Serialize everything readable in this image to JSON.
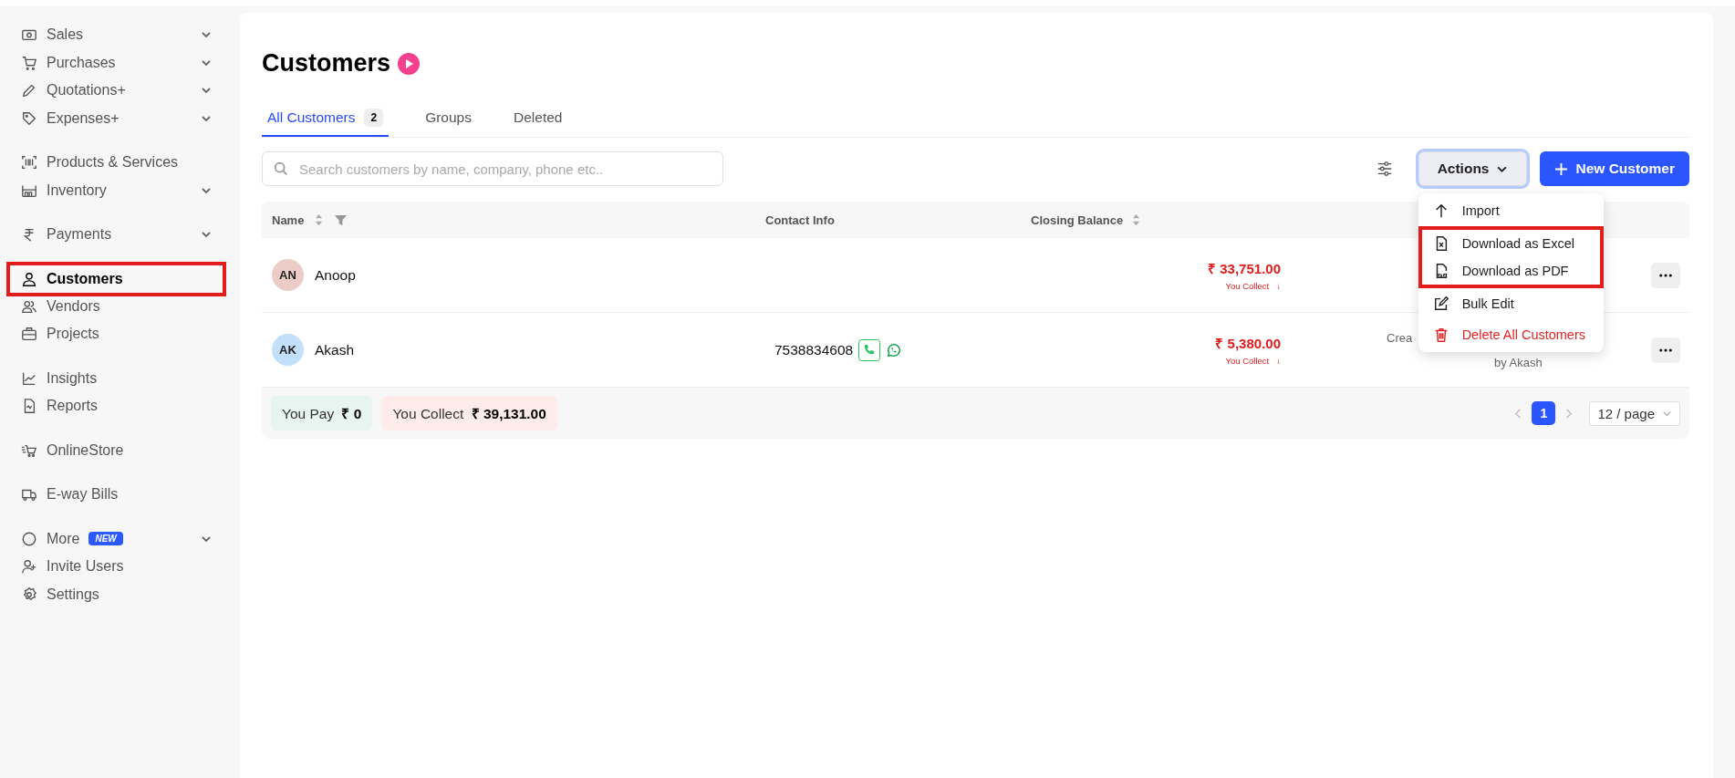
{
  "sidebar": {
    "groups": [
      {
        "items": [
          {
            "label": "Sales",
            "has_submenu": true,
            "selected": false,
            "highlighted": false
          },
          {
            "label": "Purchases",
            "has_submenu": true,
            "selected": false,
            "highlighted": false
          },
          {
            "label": "Quotations+",
            "has_submenu": true,
            "selected": false,
            "highlighted": false
          },
          {
            "label": "Expenses+",
            "has_submenu": true,
            "selected": false,
            "highlighted": false
          }
        ]
      },
      {
        "items": [
          {
            "label": "Products & Services",
            "has_submenu": false,
            "selected": false,
            "highlighted": false
          },
          {
            "label": "Inventory",
            "has_submenu": true,
            "selected": false,
            "highlighted": false
          }
        ]
      },
      {
        "items": [
          {
            "label": "Payments",
            "has_submenu": true,
            "selected": false,
            "highlighted": false
          }
        ]
      },
      {
        "items": [
          {
            "label": "Customers",
            "has_submenu": false,
            "selected": true,
            "highlighted": true
          },
          {
            "label": "Vendors",
            "has_submenu": false,
            "selected": false,
            "highlighted": false
          },
          {
            "label": "Projects",
            "has_submenu": false,
            "selected": false,
            "highlighted": false
          }
        ]
      },
      {
        "items": [
          {
            "label": "Insights",
            "has_submenu": false,
            "selected": false,
            "highlighted": false
          },
          {
            "label": "Reports",
            "has_submenu": false,
            "selected": false,
            "highlighted": false
          }
        ]
      },
      {
        "items": [
          {
            "label": "OnlineStore",
            "has_submenu": false,
            "selected": false,
            "highlighted": false
          }
        ]
      },
      {
        "items": [
          {
            "label": "E-way Bills",
            "has_submenu": false,
            "selected": false,
            "highlighted": false
          }
        ]
      },
      {
        "items": [
          {
            "label": "More",
            "badge": "NEW",
            "has_submenu": true,
            "selected": false,
            "highlighted": false
          },
          {
            "label": "Invite Users",
            "has_submenu": false,
            "selected": false,
            "highlighted": false
          },
          {
            "label": "Settings",
            "has_submenu": false,
            "selected": false,
            "highlighted": false
          }
        ]
      }
    ]
  },
  "page": {
    "title": "Customers"
  },
  "tabs": [
    {
      "label": "All Customers",
      "count": "2",
      "selected": true
    },
    {
      "label": "Groups",
      "selected": false
    },
    {
      "label": "Deleted",
      "selected": false
    }
  ],
  "search": {
    "placeholder": "Search customers by name, company, phone etc.."
  },
  "actions_button": {
    "label": "Actions",
    "expanded": true
  },
  "new_button": {
    "label": "New Customer"
  },
  "actions_menu": [
    {
      "label": "Import",
      "danger": false,
      "highlighted": false
    },
    {
      "label": "Download as Excel",
      "danger": false,
      "highlighted": true
    },
    {
      "label": "Download as PDF",
      "danger": false,
      "highlighted": true
    },
    {
      "label": "Bulk Edit",
      "danger": false,
      "highlighted": false
    },
    {
      "label": "Delete All Customers",
      "danger": true,
      "highlighted": false
    }
  ],
  "table": {
    "columns": [
      "Name",
      "Contact Info",
      "Closing Balance"
    ],
    "rows": [
      {
        "initials": "AN",
        "color": "#ebccc7",
        "name": "Anoop",
        "phone": "",
        "balance": "₹ 33,751.00",
        "balance_note": "You Collect",
        "note_arrow": "↓",
        "column_4": []
      },
      {
        "initials": "AK",
        "color": "#c2e0fb",
        "name": "Akash",
        "phone": "7538834608",
        "balance": "₹ 5,380.00",
        "balance_note": "You Collect",
        "note_arrow": "↓",
        "column_4": [
          "Crea",
          "by Akash"
        ]
      }
    ]
  },
  "summary": {
    "pay_label": "You Pay",
    "pay_value": "₹ 0",
    "collect_label": "You Collect",
    "collect_value": "₹ 39,131.00"
  },
  "pagination": {
    "pages": [
      {
        "label": "1",
        "selected": true
      }
    ],
    "page_size": "12 / page"
  }
}
